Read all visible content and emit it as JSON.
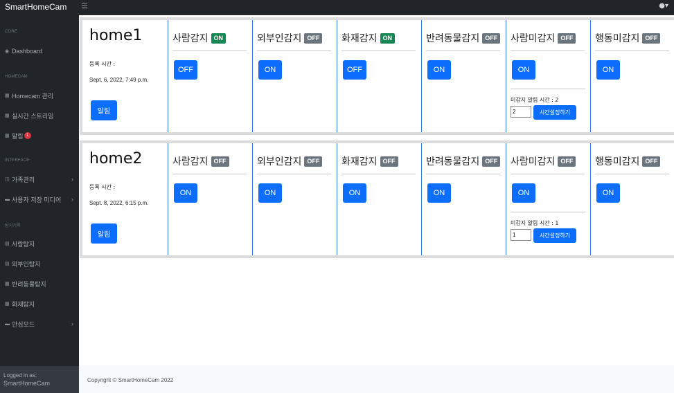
{
  "app": {
    "title": "SmartHomeCam",
    "menu_icon": "hamburger-icon",
    "user_icon": "user-icon"
  },
  "sidebar": {
    "headings": {
      "core": "CORE",
      "homecam": "HOMECAM",
      "interface": "INTERFACE",
      "detection": "탐지기록"
    },
    "items": [
      {
        "label": "Dashboard",
        "icon": "gauge-icon"
      },
      {
        "label": "Homecam 관리",
        "icon": "table-icon"
      },
      {
        "label": "실시간 스트리밍",
        "icon": "table-icon"
      },
      {
        "label": "알림",
        "icon": "table-icon",
        "badge": "1"
      },
      {
        "label": "가족관리",
        "icon": "columns-icon"
      },
      {
        "label": "사용자 저장 미디어",
        "icon": "book-icon"
      },
      {
        "label": "사람탐지",
        "icon": "chart-icon"
      },
      {
        "label": "외부인탐지",
        "icon": "chart-icon"
      },
      {
        "label": "반려동물탐지",
        "icon": "table-icon"
      },
      {
        "label": "화재탐지",
        "icon": "table-icon"
      },
      {
        "label": "안심모드",
        "icon": "book-icon"
      }
    ],
    "footer": {
      "logged_in_label": "Logged in as:",
      "user": "SmartHomeCam"
    }
  },
  "homes": [
    {
      "name": "home1",
      "reg_label": "등록 시간 :",
      "reg_date": "Sept. 6, 2022, 7:49 p.m.",
      "alarm_label": "알림",
      "features": [
        {
          "name": "사람감지",
          "status": "ON",
          "button": "OFF"
        },
        {
          "name": "외부인감지",
          "status": "OFF",
          "button": "ON"
        },
        {
          "name": "화재감지",
          "status": "ON",
          "button": "OFF"
        },
        {
          "name": "반려동물감지",
          "status": "OFF",
          "button": "ON"
        },
        {
          "name": "사람미감지",
          "status": "OFF",
          "button": "ON",
          "missing_label": "미감지 알림 시간 : 2",
          "missing_value": "2",
          "time_button": "시간설정하기"
        },
        {
          "name": "행동미감지",
          "status": "OFF",
          "button": "ON"
        }
      ]
    },
    {
      "name": "home2",
      "reg_label": "등록 시간 :",
      "reg_date": "Sept. 8, 2022, 6:15 p.m.",
      "alarm_label": "알림",
      "features": [
        {
          "name": "사람감지",
          "status": "OFF",
          "button": "ON"
        },
        {
          "name": "외부인감지",
          "status": "OFF",
          "button": "ON"
        },
        {
          "name": "화재감지",
          "status": "OFF",
          "button": "ON"
        },
        {
          "name": "반려동물감지",
          "status": "OFF",
          "button": "ON"
        },
        {
          "name": "사람미감지",
          "status": "OFF",
          "button": "ON",
          "missing_label": "미감지 알림 시간 : 1",
          "missing_value": "1",
          "time_button": "시간설정하기"
        },
        {
          "name": "행동미감지",
          "status": "OFF",
          "button": "ON"
        }
      ]
    }
  ],
  "footer": {
    "copyright": "Copyright © SmartHomeCam 2022"
  },
  "colors": {
    "primary": "#0d6efd",
    "on_badge": "#198754",
    "off_badge": "#6c757d",
    "sidebar_bg": "#212529"
  }
}
